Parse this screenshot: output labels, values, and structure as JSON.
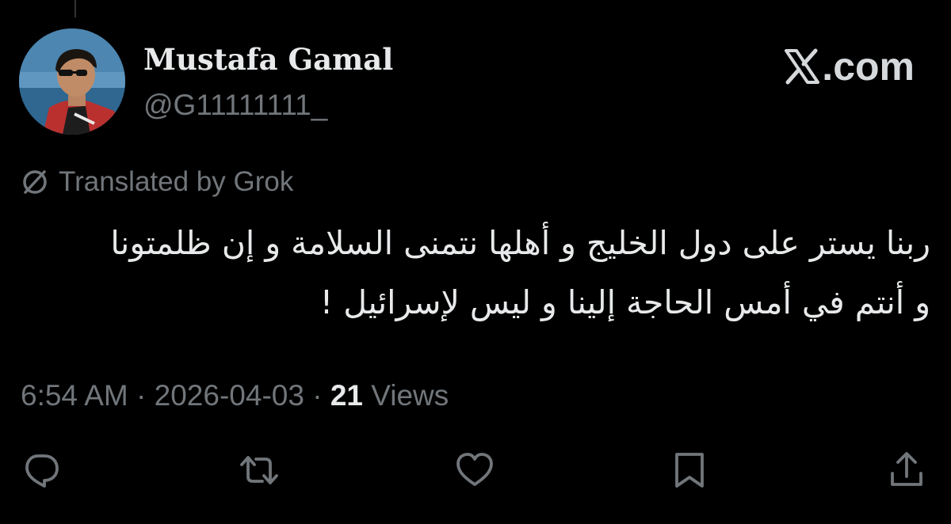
{
  "author": {
    "display_name": "Mustafa Gamal",
    "handle": "@G11111111_",
    "avatar": "avatar-photo-icon"
  },
  "brand": {
    "mark": "x-logo-icon",
    "label": ".com"
  },
  "translation": {
    "icon": "translate-icon",
    "label": "Translated by Grok"
  },
  "tweet": {
    "lines": [
      "ربنا يستر على دول الخليج و أهلها نتمنى السلامة و إن ظلمتونا",
      "و أنتم في أمس الحاجة إلينا و ليس لإسرائيل !"
    ]
  },
  "meta": {
    "time": "6:54 AM",
    "separator": " · ",
    "date": "2026-04-03",
    "views_count": "21",
    "views_label": " Views"
  },
  "actions": [
    {
      "icon": "reply-icon"
    },
    {
      "icon": "retweet-icon"
    },
    {
      "icon": "like-icon"
    },
    {
      "icon": "bookmark-icon"
    },
    {
      "icon": "share-icon"
    }
  ],
  "colors": {
    "background": "#000000",
    "primary_text": "#e7e9ea",
    "secondary_text": "#71767b"
  }
}
